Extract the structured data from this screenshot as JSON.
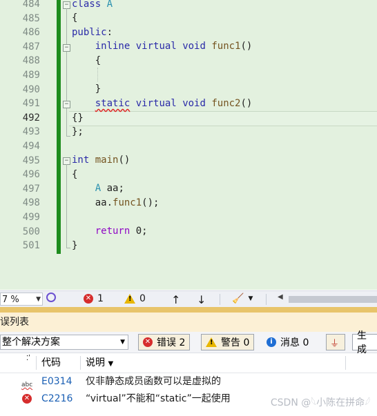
{
  "editor": {
    "line_numbers": [
      "484",
      "485",
      "486",
      "487",
      "488",
      "489",
      "490",
      "491",
      "492",
      "493",
      "494",
      "495",
      "496",
      "497",
      "498",
      "499",
      "500",
      "501"
    ],
    "active_line": "492",
    "lines": [
      {
        "id": "l484",
        "text": "class A"
      },
      {
        "id": "l485",
        "text": "{"
      },
      {
        "id": "l486",
        "text": "public:"
      },
      {
        "id": "l487",
        "text": "    inline virtual void func1()"
      },
      {
        "id": "l488",
        "text": "    {"
      },
      {
        "id": "l489",
        "text": ""
      },
      {
        "id": "l490",
        "text": "    }"
      },
      {
        "id": "l491",
        "text": "    static virtual void func2()"
      },
      {
        "id": "l492",
        "text": "{}"
      },
      {
        "id": "l493",
        "text": "};"
      },
      {
        "id": "l494",
        "text": ""
      },
      {
        "id": "l495",
        "text": "int main()"
      },
      {
        "id": "l496",
        "text": "{"
      },
      {
        "id": "l497",
        "text": "    A aa;"
      },
      {
        "id": "l498",
        "text": "    aa.func1();"
      },
      {
        "id": "l499",
        "text": ""
      },
      {
        "id": "l500",
        "text": "    return 0;"
      },
      {
        "id": "l501",
        "text": "}"
      }
    ],
    "tokens": {
      "class_kw": "class",
      "class_name": "A",
      "public_kw": "public",
      "inline_kw": "inline",
      "virtual_kw": "virtual",
      "void_kw": "void",
      "func1": "func1",
      "static_kw": "static",
      "func2": "func2",
      "int_kw": "int",
      "main_fn": "main",
      "type_A": "A",
      "return_kw": "return"
    }
  },
  "status_strip": {
    "zoom": "7 %",
    "error_count": "1",
    "warning_count": "0"
  },
  "error_list": {
    "title": "错误列表",
    "scope": "整个解决方案",
    "errors_btn": "错误 2",
    "warnings_btn": "警告 0",
    "messages_btn": "消息 0",
    "build_btn": "生成",
    "columns": {
      "code": "代码",
      "desc": "说明"
    },
    "rows": [
      {
        "code": "E0314",
        "desc": "仅非静态成员函数可以是虚拟的",
        "icon": "intellisense-abc-icon"
      },
      {
        "code": "C2216",
        "desc": "“virtual”不能和“static”一起使用",
        "icon": "error-icon"
      }
    ]
  },
  "watermark": "CSDN @𓆩小陈在拼命𓆪",
  "colors": {
    "change_bar": "#1e8c1e",
    "editor_bg": "#e3f1df",
    "keyword": "#2a2aa8",
    "error": "#d62d2d",
    "link": "#1a5fb4"
  }
}
